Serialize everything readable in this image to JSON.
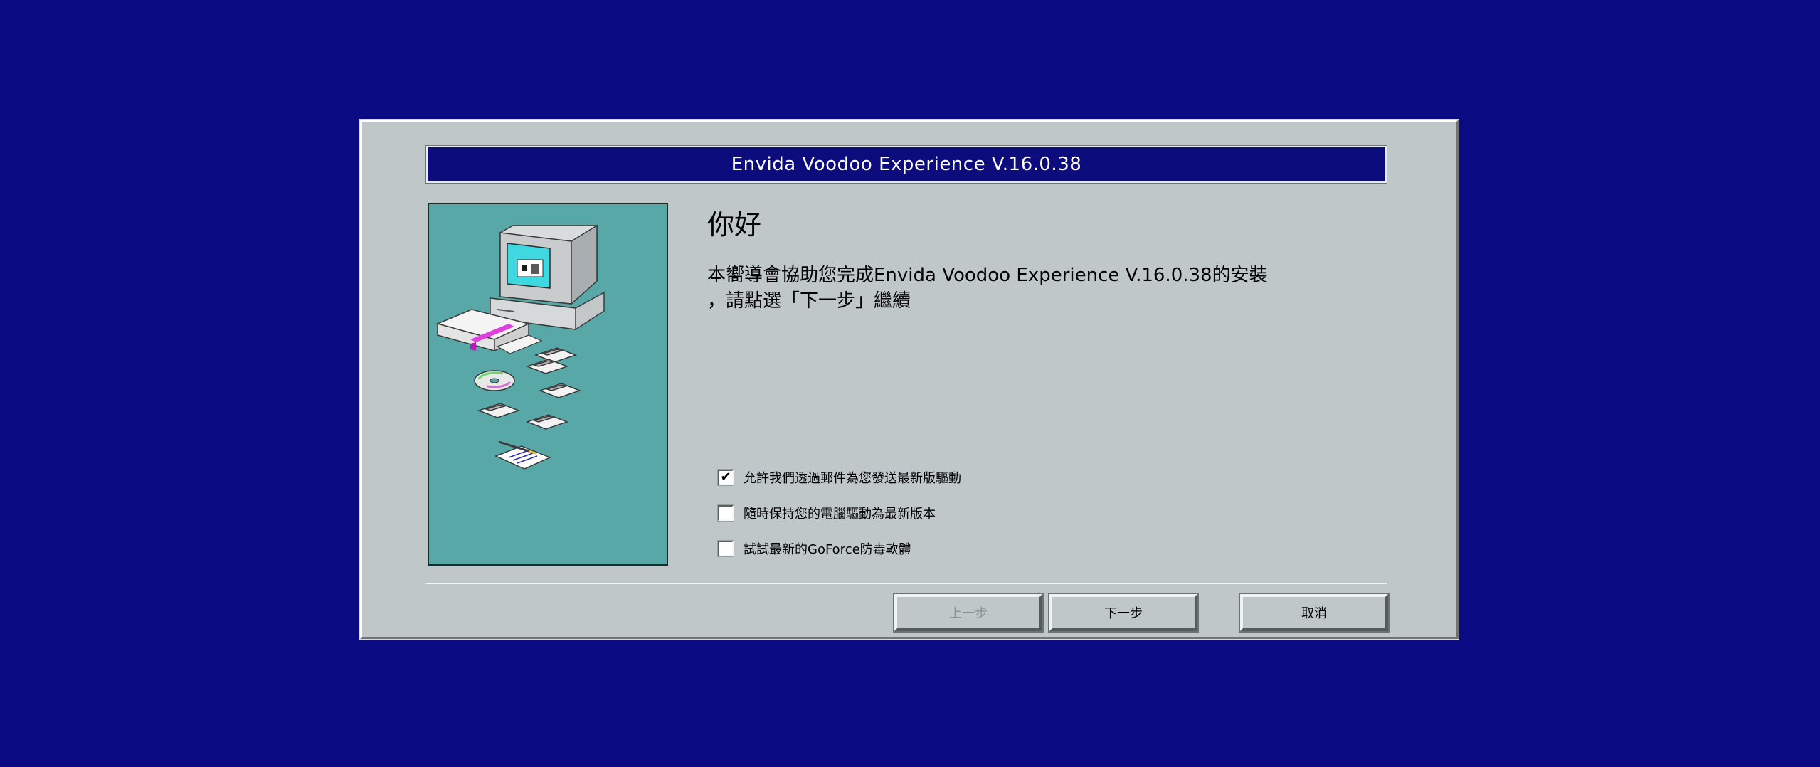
{
  "window": {
    "title": "Envida Voodoo Experience V.16.0.38"
  },
  "main": {
    "greeting": "你好",
    "intro_line1": "本嚮導會協助您完成Envida Voodoo Experience V.16.0.38的安裝",
    "intro_line2": "，請點選「下一步」繼續"
  },
  "options": [
    {
      "label": "允許我們透過郵件為您發送最新版驅動",
      "checked": true,
      "mark": "✔"
    },
    {
      "label": "隨時保持您的電腦驅動為最新版本",
      "checked": false,
      "mark": ""
    },
    {
      "label": "試試最新的GoForce防毒軟體",
      "checked": false,
      "mark": ""
    }
  ],
  "buttons": {
    "back": "上一步",
    "next": "下一步",
    "cancel": "取消"
  },
  "colors": {
    "desktop": "#0a0a82",
    "title_bar": "#0c0c7c",
    "dialog": "#bfc7c9",
    "art_panel": "#59a8a8",
    "art_accent": "#e040e0",
    "screen": "#40d8e0"
  }
}
